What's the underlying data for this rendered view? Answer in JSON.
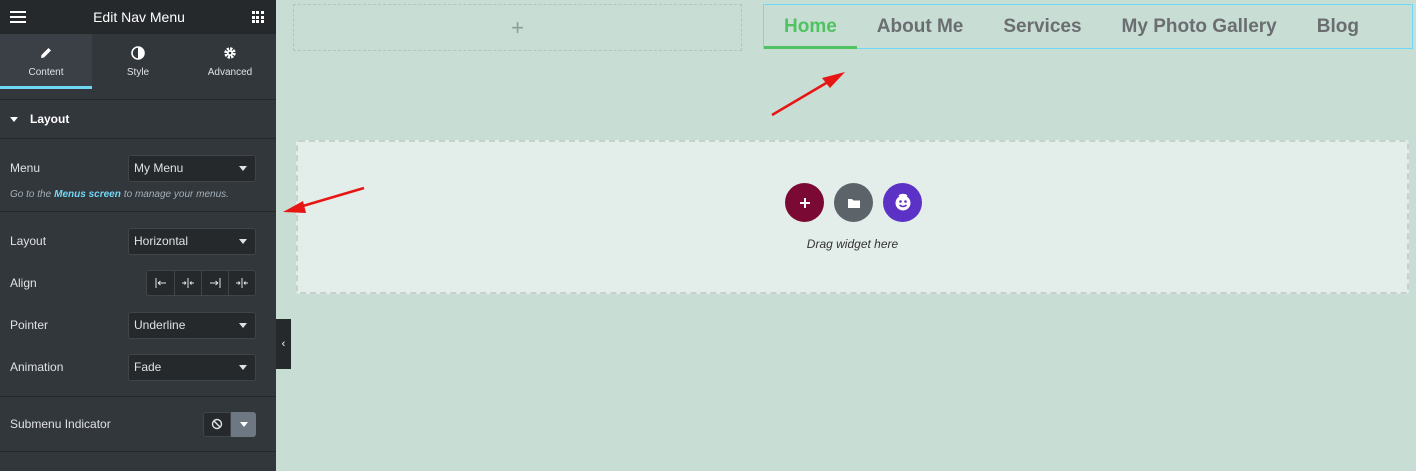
{
  "panel": {
    "title": "Edit Nav Menu",
    "tabs": [
      {
        "label": "Content",
        "icon": "pencil-icon",
        "active": true
      },
      {
        "label": "Style",
        "icon": "half-circle-icon",
        "active": false
      },
      {
        "label": "Advanced",
        "icon": "gear-icon",
        "active": false
      }
    ],
    "section_title": "Layout",
    "menu": {
      "label": "Menu",
      "value": "My Menu"
    },
    "note": {
      "prefix": "Go to the",
      "link": "Menus screen",
      "suffix": "to manage your menus."
    },
    "layout": {
      "label": "Layout",
      "value": "Horizontal"
    },
    "align": {
      "label": "Align"
    },
    "pointer": {
      "label": "Pointer",
      "value": "Underline"
    },
    "animation": {
      "label": "Animation",
      "value": "Fade"
    },
    "submenu_indicator": {
      "label": "Submenu Indicator"
    }
  },
  "canvas": {
    "add_section_glyph": "+",
    "nav": {
      "items": [
        "Home",
        "About Me",
        "Services",
        "My Photo Gallery",
        "Blog"
      ],
      "active_index": 0
    },
    "dropzone": {
      "text": "Drag widget here"
    }
  },
  "colors": {
    "panel_bg": "#32373c",
    "accent": "#71d7f7",
    "nav_active": "#4fc35f",
    "canvas_bg": "#c8ddd4",
    "annotation_arrow": "#e81515"
  }
}
